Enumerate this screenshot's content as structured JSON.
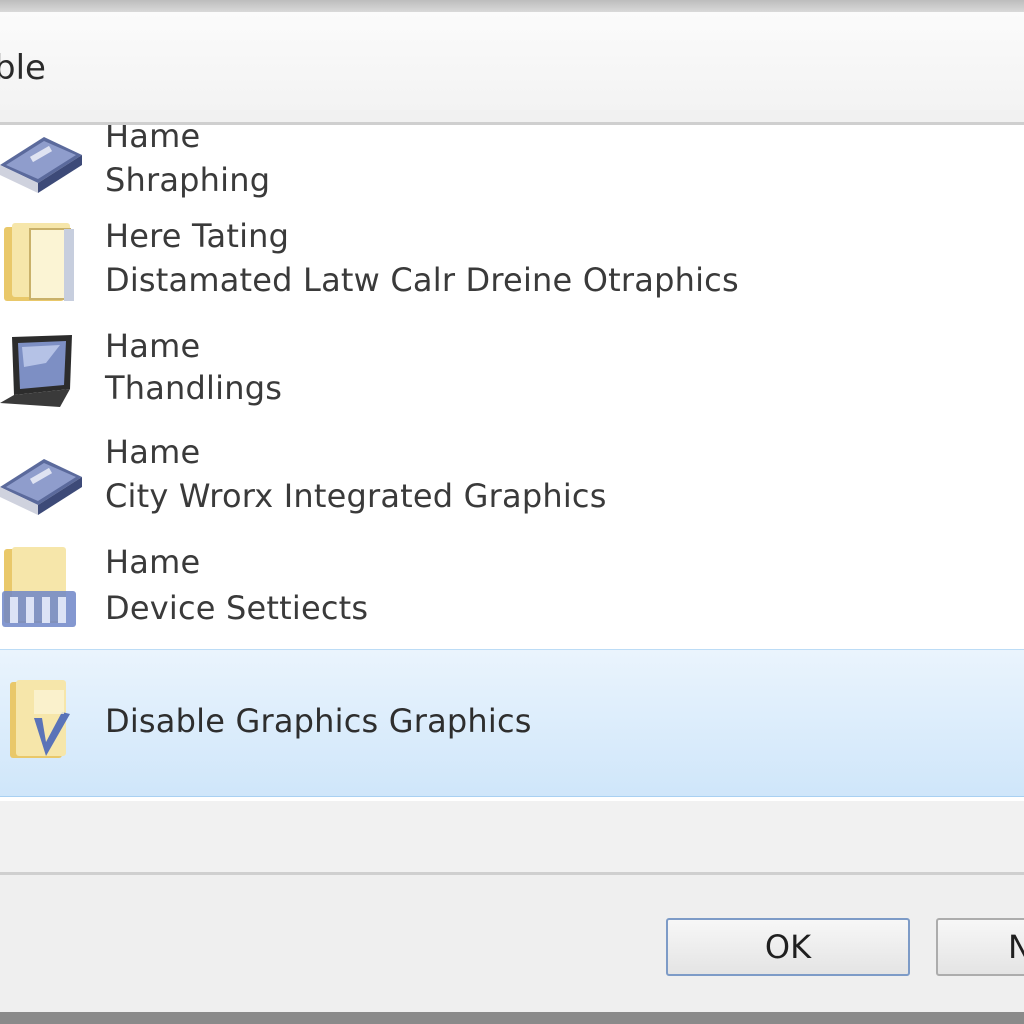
{
  "window": {
    "title": "ble"
  },
  "list": {
    "items": [
      {
        "line1": "Hame",
        "line2": "Shraphing",
        "icon": "book-icon"
      },
      {
        "line1": "Here Tating",
        "line2": "Distamated Latw Calr Dreine Otraphics",
        "icon": "folder-icon"
      },
      {
        "line1": "Hame",
        "line2": "Thandlings",
        "icon": "laptop-icon"
      },
      {
        "line1": "Hame",
        "line2": "City Wrorx Integrated Graphics",
        "icon": "book-icon"
      },
      {
        "line1": "Hame",
        "line2": "Device Settiects",
        "icon": "folder-device-icon"
      },
      {
        "line1": "Disable Graphics Graphics",
        "line2": "",
        "icon": "folder-check-icon",
        "selected": true
      }
    ]
  },
  "footer": {
    "ok_label": "OK",
    "next_label": "N"
  },
  "colors": {
    "selection": "#cfe6fa",
    "button_border": "#7d9bc7",
    "folder": "#f2d98b"
  }
}
